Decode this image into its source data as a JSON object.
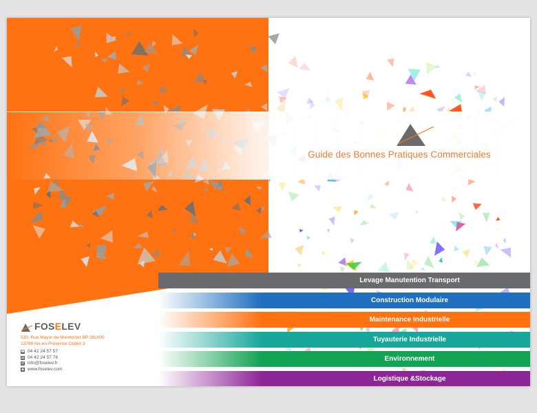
{
  "title": "Guide des Bonnes Pratiques Commerciales",
  "brand": {
    "prefix": "FOS",
    "highlight": "E",
    "suffix": "LEV"
  },
  "address": [
    "530, Rue Mayor de Montricher BP 291000",
    "13798 Aix-en-Provence Cedex 3"
  ],
  "contacts": [
    {
      "icon": "phone-icon",
      "text": "04 42 24 57 57"
    },
    {
      "icon": "fax-icon",
      "text": "04 42 24 57 76"
    },
    {
      "icon": "email-icon",
      "text": "info@foselev.fr"
    },
    {
      "icon": "web-icon",
      "text": "www.foselev.com"
    }
  ],
  "divisions": [
    {
      "label": "Levage Manutention Transport",
      "color": "#6a6a6d"
    },
    {
      "label": "Construction Modulaire",
      "color": "#1f6fc0"
    },
    {
      "label": "Maintenance Industrielle",
      "color": "#ff7211"
    },
    {
      "label": "Tuyauterie Industrielle",
      "color": "#17a89b"
    },
    {
      "label": "Environnement",
      "color": "#12a354"
    },
    {
      "label": "Logistique &Stockage",
      "color": "#8e2597"
    }
  ],
  "colors": {
    "orange": "#ff7211",
    "title": "#ee7d33",
    "grey": "#5a5a5a"
  }
}
